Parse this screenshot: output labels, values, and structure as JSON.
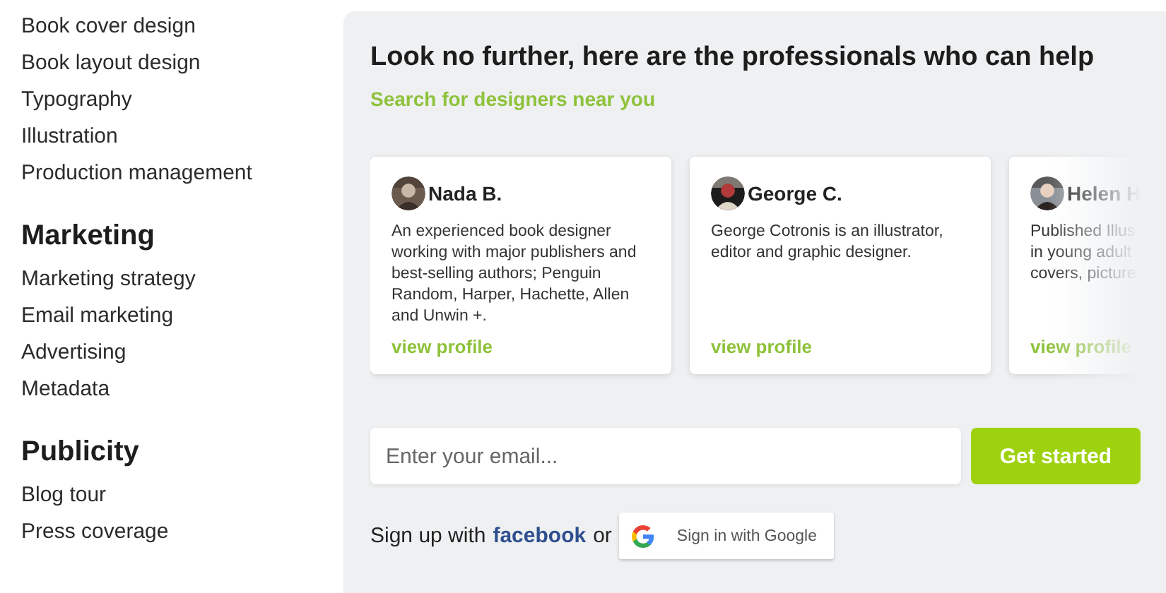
{
  "sidebar": {
    "groups": [
      {
        "items": [
          "Book cover design",
          "Book layout design",
          "Typography",
          "Illustration",
          "Production management"
        ]
      },
      {
        "heading": "Marketing",
        "items": [
          "Marketing strategy",
          "Email marketing",
          "Advertising",
          "Metadata"
        ]
      },
      {
        "heading": "Publicity",
        "items": [
          "Blog tour",
          "Press coverage"
        ]
      }
    ]
  },
  "main": {
    "title": "Look no further, here are the professionals who can help",
    "subtitle": "Search for designers near you",
    "designers": [
      {
        "name": "Nada B.",
        "bio": [
          "An experienced book designer working with major publishers and best-selling authors; Penguin Random, Harper, Hachette, Allen and Unwin +."
        ],
        "link": "view profile",
        "cut": false
      },
      {
        "name": "George C.",
        "bio": [
          "George Cotronis is an illustrator, editor and graphic designer."
        ],
        "link": "view profile",
        "cut": false
      },
      {
        "name": "Helen H",
        "bio": [
          "Published Illus",
          "in young adult",
          "covers, picture"
        ],
        "link": "view profile",
        "cut": true
      }
    ],
    "email": {
      "placeholder": "Enter your email..."
    },
    "cta": "Get started",
    "signup": {
      "prefix": "Sign up with",
      "facebook": "facebook",
      "or": "or",
      "google": "Sign in with Google"
    }
  }
}
